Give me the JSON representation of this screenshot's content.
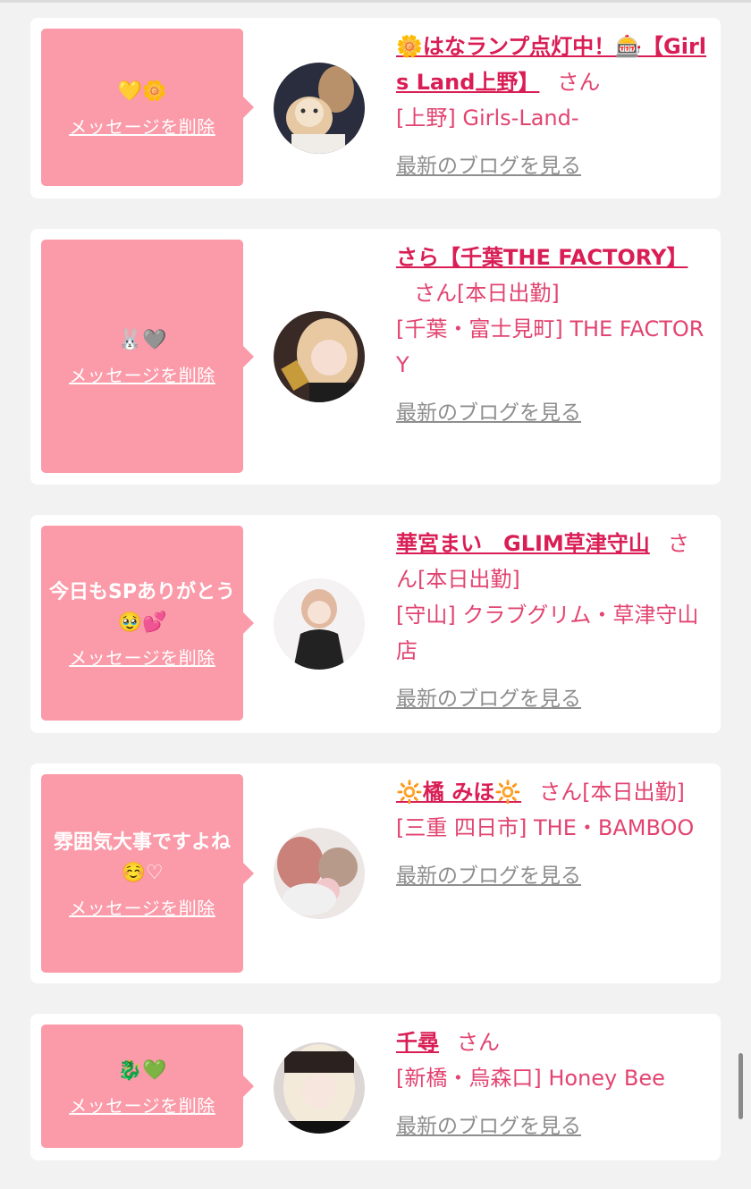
{
  "delete_label": "メッセージを削除",
  "blog_label": "最新のブログを見る",
  "san_suffix": "さん",
  "cards": [
    {
      "message": "💛🌼",
      "name": "🌼はなランプ点灯中！🎰【Girls Land上野】",
      "status": "",
      "shop": "[上野] Girls-Land-",
      "avatar": "avatar-with-cat"
    },
    {
      "message": "🐰🩶",
      "name": "さら【千葉THE FACTORY】",
      "status": "[本日出勤]",
      "shop": "[千葉・富士見町] THE FACTORY",
      "avatar": "avatar-blonde"
    },
    {
      "message": "今日もSPありがとう🥹💕",
      "name": "華宮まい　GLIM草津守山",
      "status": "[本日出勤]",
      "shop": "[守山] クラブグリム・草津守山店",
      "avatar": "avatar-white-bg"
    },
    {
      "message": "雰囲気大事ですよね☺️♡",
      "name": "🔆橘 みほ🔆",
      "status": "[本日出勤]",
      "shop": "[三重 四日市] THE・BAMBOO",
      "avatar": "avatar-flowers"
    },
    {
      "message": "🐉💚",
      "name": "千尋",
      "status": "",
      "shop": "[新橋・烏森口] Honey Bee",
      "avatar": "avatar-blonde-bangs"
    }
  ]
}
